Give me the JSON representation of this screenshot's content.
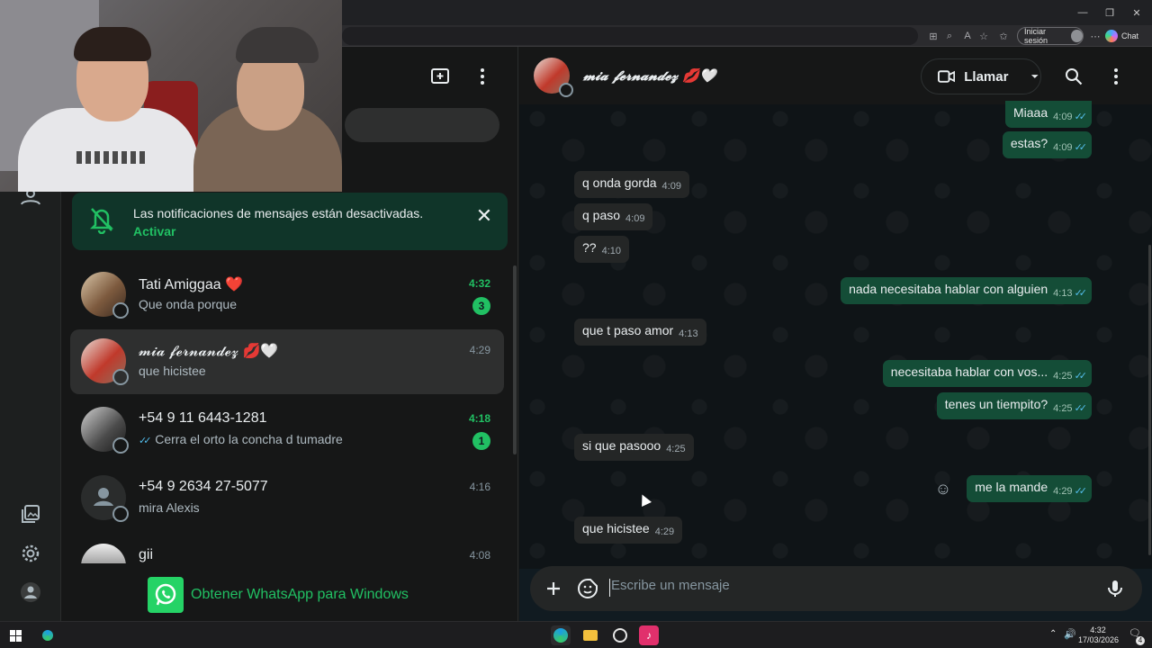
{
  "browser": {
    "signin_label": "Iniciar sesión",
    "chat_label": "Chat"
  },
  "notification_banner": {
    "title": "Las notificaciones de mensajes están desactivadas.",
    "action": "Activar"
  },
  "chats": [
    {
      "name": "Tati Amiggaa",
      "emoji": "❤️",
      "message": "Que onda porque",
      "time": "4:32",
      "unread": "3",
      "unread_state": true
    },
    {
      "name": "𝓶𝓲𝓪 𝓯𝓮𝓻𝓷𝓪𝓷𝓭𝓮𝔃",
      "emoji": "💋🤍",
      "message": "que hicistee",
      "time": "4:29",
      "selected": true
    },
    {
      "name": "+54 9 11 6443-1281",
      "message": "Cerra el orto la concha d tumadre",
      "time": "4:18",
      "unread": "1",
      "unread_state": true,
      "sent_ticks": true
    },
    {
      "name": "+54 9 2634 27-5077",
      "message": "mira Alexis",
      "time": "4:16"
    },
    {
      "name": "gii",
      "message": "",
      "time": "4:08"
    }
  ],
  "get_whatsapp": "Obtener WhatsApp para Windows",
  "conversation": {
    "contact_name": "𝓶𝓲𝓪 𝓯𝓮𝓻𝓷𝓪𝓷𝓭𝓮𝔃",
    "contact_emoji": "💋🤍",
    "call_label": "Llamar",
    "composer_placeholder": "Escribe un mensaje",
    "messages": [
      {
        "dir": "out",
        "text": "Miaaa",
        "time": "4:09"
      },
      {
        "dir": "out",
        "text": "estas?",
        "time": "4:09"
      },
      {
        "dir": "in",
        "text": "q onda gorda",
        "time": "4:09"
      },
      {
        "dir": "in",
        "text": "q paso",
        "time": "4:09"
      },
      {
        "dir": "in",
        "text": "??",
        "time": "4:10"
      },
      {
        "dir": "out",
        "text": "nada necesitaba hablar con alguien",
        "time": "4:13"
      },
      {
        "dir": "in",
        "text": "que t paso amor",
        "time": "4:13"
      },
      {
        "dir": "out",
        "text": "necesitaba hablar con vos...",
        "time": "4:25"
      },
      {
        "dir": "out",
        "text": "tenes un tiempito?",
        "time": "4:25"
      },
      {
        "dir": "in",
        "text": "si que pasooo",
        "time": "4:25"
      },
      {
        "dir": "out",
        "text": "me la mande",
        "time": "4:29"
      },
      {
        "dir": "in",
        "text": "que hicistee",
        "time": "4:29"
      }
    ]
  },
  "taskbar": {
    "time": "4:32",
    "date": "17/03/2026",
    "notif_count": "4"
  },
  "colors": {
    "accent_green": "#21c063",
    "outgoing_bubble": "#144d37",
    "incoming_bubble": "#242626",
    "read_ticks": "#53bdeb"
  }
}
